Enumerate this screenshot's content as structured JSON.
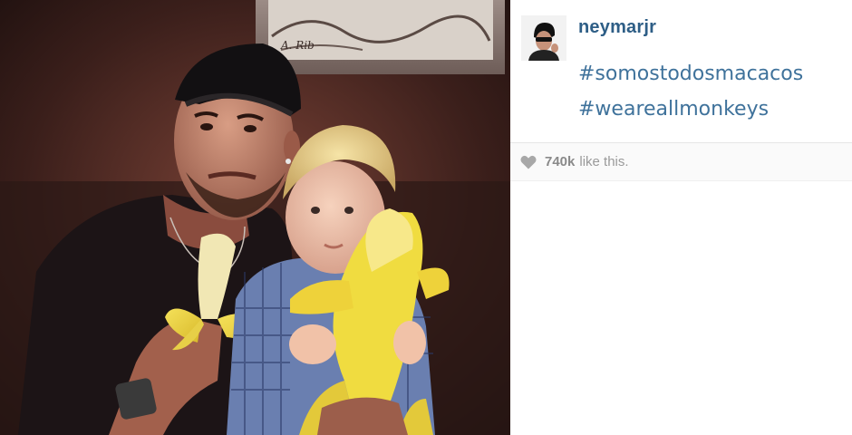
{
  "post": {
    "username": "neymarjr",
    "caption_tags": [
      "#somostodosmacacos",
      "#weareallmonkeys"
    ],
    "likes": {
      "count": "740k",
      "suffix": "like this."
    },
    "photo_description_icon": "photo",
    "avatar_icon": "user-avatar"
  },
  "colors": {
    "link_blue": "#3f729b",
    "username_blue": "#2e5e86",
    "like_gray": "#8a8a8a",
    "heart_gray": "#a8a8a8"
  }
}
